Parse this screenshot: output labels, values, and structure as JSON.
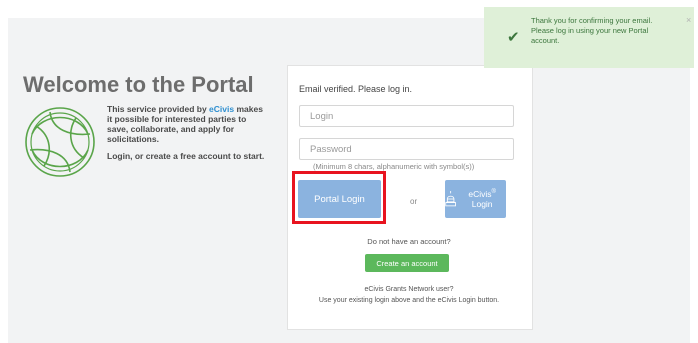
{
  "welcome": {
    "title": "Welcome to the Portal",
    "intro_prefix": "This service provided by ",
    "intro_link": "eCivis",
    "intro_suffix": " makes it possible for interested parties to save, collaborate, and apply for solicitations.",
    "intro_cta": "Login, or create a free account to start."
  },
  "login": {
    "message": "Email verified. Please log in.",
    "login_placeholder": "Login",
    "password_placeholder": "Password",
    "password_hint": "(Minimum 8 chars, alphanumeric with symbol(s))",
    "portal_login_label": "Portal Login",
    "or_label": "or",
    "ecivis_login_label": "eCivis",
    "ecivis_login_reg": "®",
    "ecivis_login_suffix": " Login",
    "ecivis_icon": "capitol-dome-icon",
    "no_account_text": "Do not have an account?",
    "create_account_label": "Create an account",
    "gn_line1": "eCivis Grants Network user?",
    "gn_line2": "Use your existing login above and the eCivis Login button."
  },
  "toast": {
    "message": "Thank you for confirming your email. Please log in using your new Portal account.",
    "close_label": "×",
    "check_icon": "check-icon",
    "colors": {
      "background": "#dff0d8",
      "text": "#3c763d"
    }
  },
  "annotation": {
    "highlight_color": "#e8131f"
  }
}
